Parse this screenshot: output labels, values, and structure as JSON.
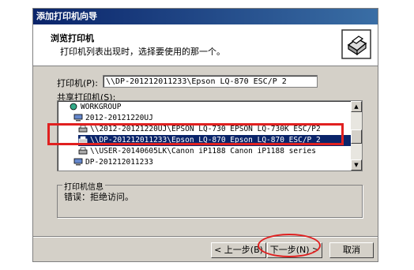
{
  "window": {
    "title": "添加打印机向导"
  },
  "header": {
    "title": "浏览打印机",
    "subtitle": "打印机列表出现时，选择要使用的那一个。",
    "icon": "printer-icon"
  },
  "printer_field": {
    "label": "打印机(P):",
    "value": "\\\\DP-201212011233\\Epson LQ-870 ESC/P 2"
  },
  "shared_list": {
    "label": "共享打印机(S):",
    "rows": [
      {
        "text": "WORKGROUP",
        "icon": "network-icon"
      },
      {
        "text": "2012-20121220UJ",
        "icon": "computer-icon"
      },
      {
        "text": "\\\\2012-20121220UJ\\EPSON LQ-730 EPSON LQ-730K ESC/P2",
        "icon": "printer-icon"
      },
      {
        "text": "\\\\DP-201212011233\\Epson LQ-870 Epson LQ-870 ESC/P 2",
        "icon": "printer-icon",
        "selected": true
      },
      {
        "text": "\\\\USER-20140605LK\\Canon iP1188 Canon iP1188 series",
        "icon": "printer-icon"
      },
      {
        "text": "DP-201212011233",
        "icon": "computer-icon"
      }
    ]
  },
  "info_group": {
    "title": "打印机信息",
    "text": "错误：拒绝访问。"
  },
  "buttons": {
    "back": "< 上一步(B)",
    "next": "下一步(N) >",
    "cancel": "取消"
  },
  "colors": {
    "selection": "#0a246a",
    "highlight": "#e02020",
    "dialog": "#d4d0c8"
  }
}
